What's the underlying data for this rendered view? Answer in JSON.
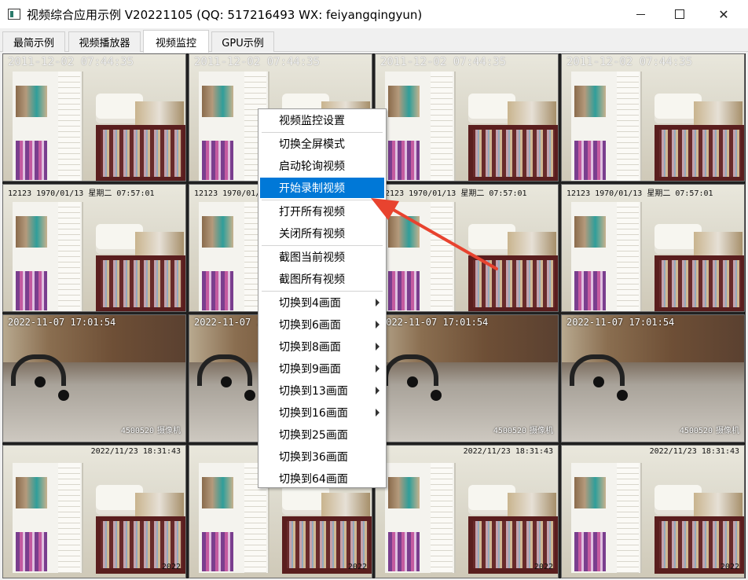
{
  "window": {
    "title": "视频综合应用示例 V20221105 (QQ: 517216493 WX: feiyangqingyun)",
    "icon": "app-window-icon",
    "controls": [
      "minimize-icon",
      "maximize-icon",
      "close-icon"
    ]
  },
  "tabs": [
    {
      "label": "最简示例",
      "active": false
    },
    {
      "label": "视频播放器",
      "active": false
    },
    {
      "label": "视频监控",
      "active": true
    },
    {
      "label": "GPU示例",
      "active": false
    }
  ],
  "video_osd": {
    "row1": "2011-12-02 07:44:35",
    "row2": "12123  1970/01/13 星期二 07:57:01",
    "row3": "2022-11-07 17:01:54",
    "row4_top": "2022/11/23 18:31:43",
    "row3_bottom": "4500520",
    "cam_label": "摄像机",
    "row4_bottom": "2022"
  },
  "context_menu": {
    "items": [
      {
        "label": "视频监控设置",
        "submenu": false,
        "highlighted": false
      },
      {
        "label": "切换全屏模式",
        "submenu": false,
        "highlighted": false
      },
      {
        "label": "启动轮询视频",
        "submenu": false,
        "highlighted": false
      },
      {
        "label": "开始录制视频",
        "submenu": false,
        "highlighted": true
      },
      {
        "label": "打开所有视频",
        "submenu": false,
        "highlighted": false
      },
      {
        "label": "关闭所有视频",
        "submenu": false,
        "highlighted": false
      },
      {
        "label": "截图当前视频",
        "submenu": false,
        "highlighted": false
      },
      {
        "label": "截图所有视频",
        "submenu": false,
        "highlighted": false
      },
      {
        "label": "切换到4画面",
        "submenu": true,
        "highlighted": false
      },
      {
        "label": "切换到6画面",
        "submenu": true,
        "highlighted": false
      },
      {
        "label": "切换到8画面",
        "submenu": true,
        "highlighted": false
      },
      {
        "label": "切换到9画面",
        "submenu": true,
        "highlighted": false
      },
      {
        "label": "切换到13画面",
        "submenu": true,
        "highlighted": false
      },
      {
        "label": "切换到16画面",
        "submenu": true,
        "highlighted": false
      },
      {
        "label": "切换到25画面",
        "submenu": false,
        "highlighted": false
      },
      {
        "label": "切换到36画面",
        "submenu": false,
        "highlighted": false
      },
      {
        "label": "切换到64画面",
        "submenu": false,
        "highlighted": false
      }
    ]
  },
  "colors": {
    "highlight": "#0078d7",
    "annotation_arrow": "#e8432f"
  }
}
